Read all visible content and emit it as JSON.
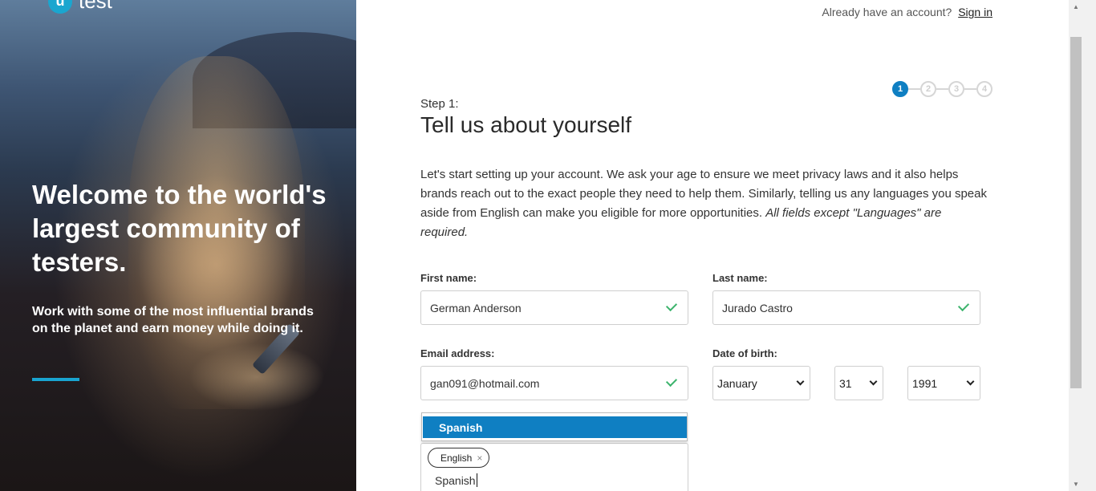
{
  "brand": {
    "logo_mark": "u",
    "logo_text": "test"
  },
  "hero": {
    "title": "Welcome to the world's largest community of testers.",
    "subtitle": "Work with some of the most influential brands on the planet and earn money while doing it."
  },
  "header": {
    "have_account": "Already have an account?",
    "sign_in": "Sign in"
  },
  "stepper": {
    "steps": [
      "1",
      "2",
      "3",
      "4"
    ],
    "current": 1
  },
  "form": {
    "step_label": "Step 1:",
    "title": "Tell us about yourself",
    "intro": "Let's start setting up your account. We ask your age to ensure we meet privacy laws and it also helps brands reach out to the exact people they need to help them. Similarly, telling us any languages you speak aside from English can make you eligible for more opportunities. ",
    "intro_note": "All fields except \"Languages\" are required.",
    "first_name": {
      "label": "First name:",
      "value": "German Anderson"
    },
    "last_name": {
      "label": "Last name:",
      "value": "Jurado Castro"
    },
    "email": {
      "label": "Email address:",
      "value": "gan091@hotmail.com"
    },
    "dob": {
      "label": "Date of birth:",
      "month": "January",
      "day": "31",
      "year": "1991"
    },
    "languages": {
      "dropdown_option": "Spanish",
      "chips": [
        "English"
      ],
      "chip_remove": "×",
      "input_value": "Spanish"
    }
  },
  "colors": {
    "accent": "#0f7fc2",
    "brand": "#1aa6cf",
    "valid": "#3db46d"
  },
  "icons": [
    "check-icon",
    "chevron-down-icon",
    "close-icon"
  ]
}
